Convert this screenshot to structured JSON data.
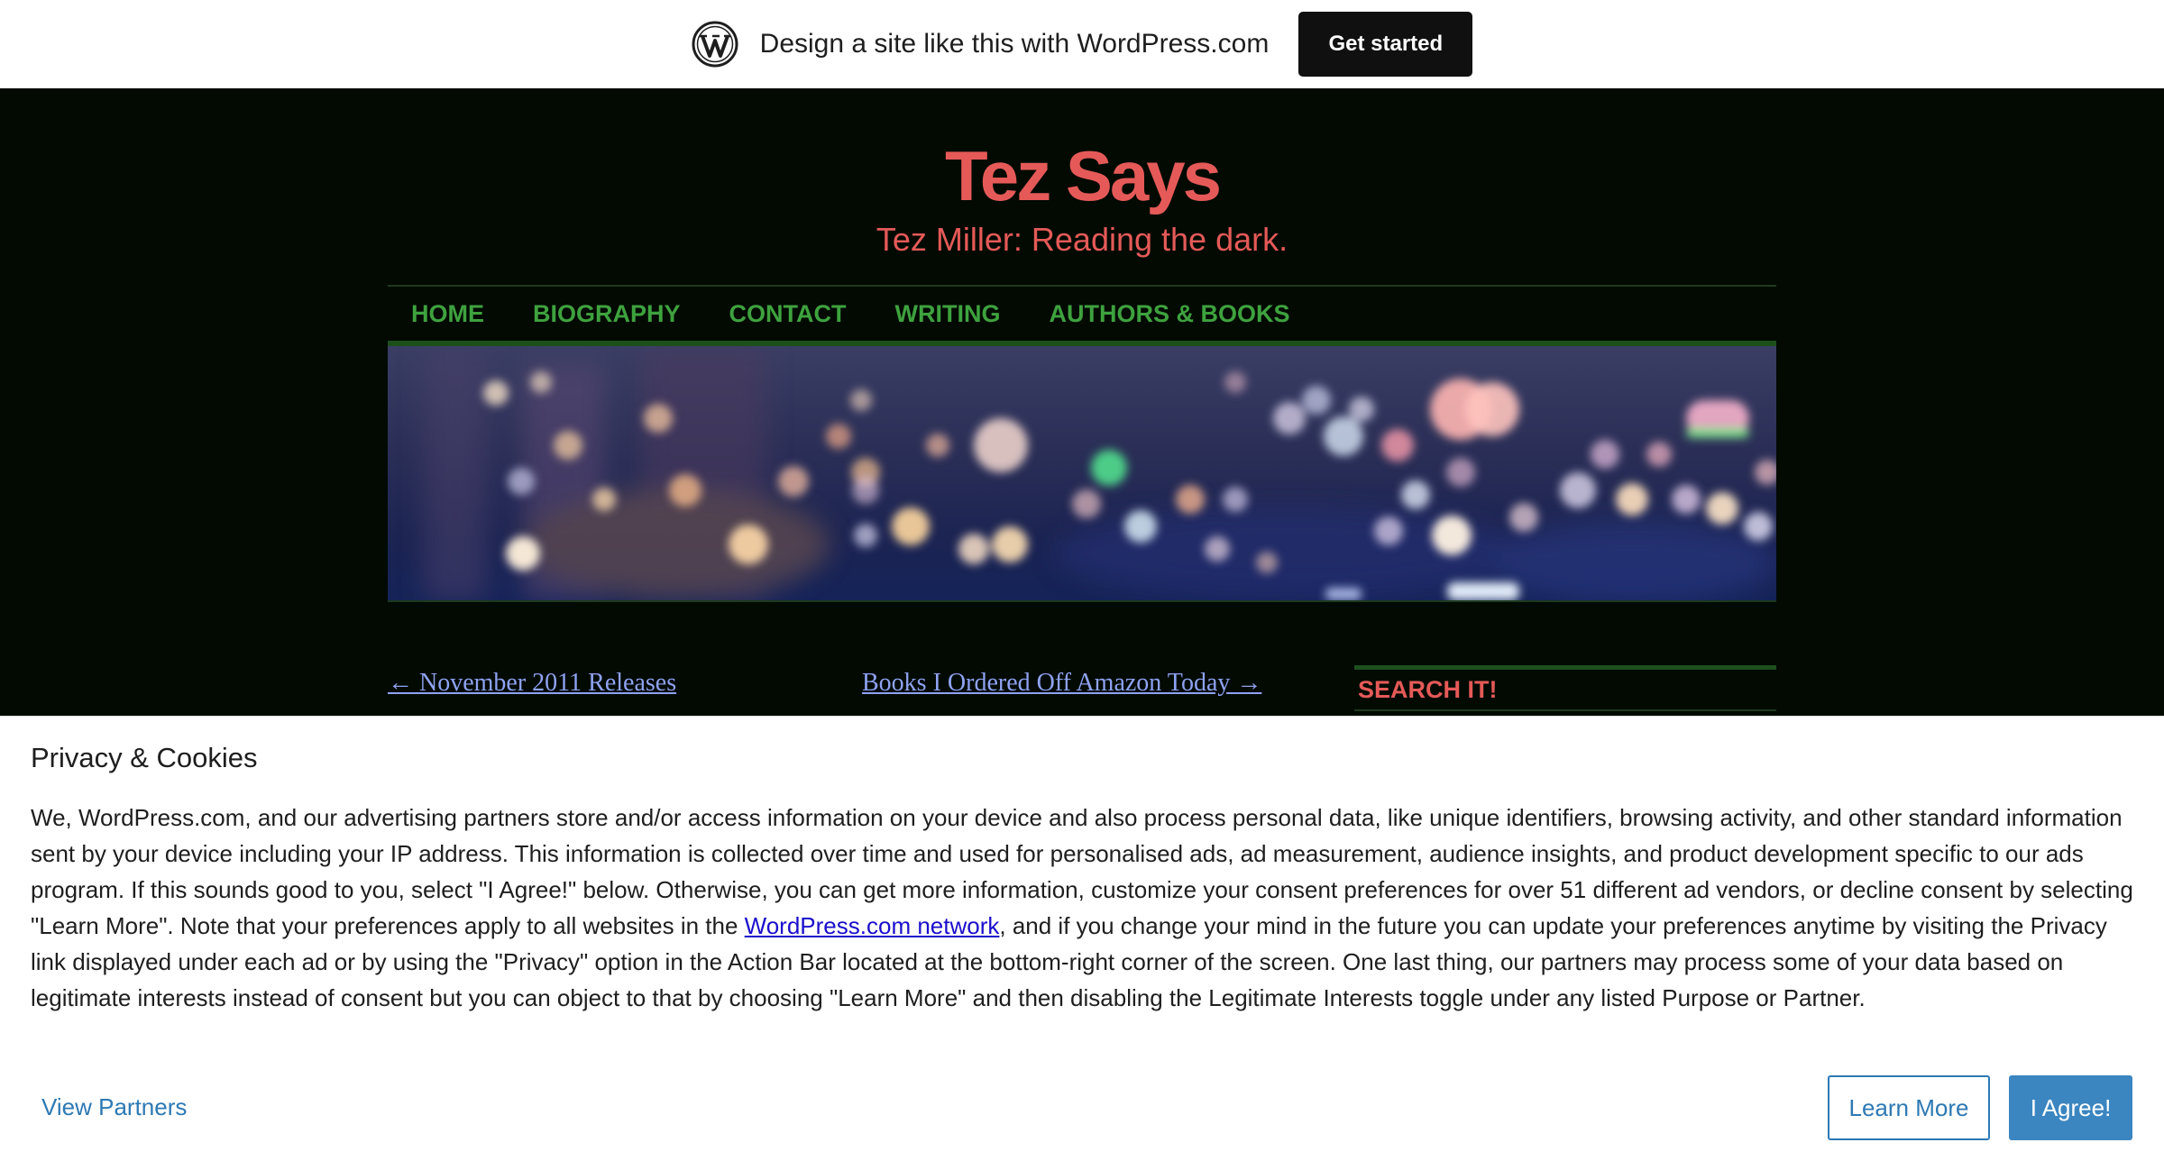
{
  "wp_bar": {
    "promo_text": "Design a site like this with WordPress.com",
    "cta_label": "Get started",
    "logo_icon": "wordpress-logo-icon"
  },
  "site": {
    "title": "Tez Says",
    "tagline": "Tez Miller: Reading the dark.",
    "accent_color": "#e55a58",
    "nav_color": "#3ea23e"
  },
  "nav": {
    "items": [
      {
        "label": "HOME"
      },
      {
        "label": "BIOGRAPHY"
      },
      {
        "label": "CONTACT"
      },
      {
        "label": "WRITING"
      },
      {
        "label": "AUTHORS & BOOKS"
      }
    ]
  },
  "post_nav": {
    "previous": "← November 2011 Releases",
    "next": "Books I Ordered Off Amazon Today →"
  },
  "sidebar": {
    "search_heading": "SEARCH IT!"
  },
  "privacy": {
    "title": "Privacy & Cookies",
    "body_part1": "We, WordPress.com, and our advertising partners store and/or access information on your device and also process personal data, like unique identifiers, browsing activity, and other standard information sent by your device including your IP address. This information is collected over time and used for personalised ads, ad measurement, audience insights, and product development specific to our ads program. If this sounds good to you, select \"I Agree!\" below. Otherwise, you can get more information, customize your consent preferences for over 51 different ad vendors, or decline consent by selecting \"Learn More\". Note that your preferences apply to all websites in the ",
    "network_link": "WordPress.com network",
    "body_part2": ", and if you change your mind in the future you can update your preferences anytime by visiting the Privacy link displayed under each ad or by using the \"Privacy\" option in the Action Bar located at the bottom-right corner of the screen. One last thing, our partners may process some of your data based on legitimate interests instead of consent but you can object to that by choosing \"Learn More\" and then disabling the Legitimate Interests toggle under any listed Purpose or Partner.",
    "view_partners_label": "View Partners",
    "learn_more_label": "Learn More",
    "agree_label": "I Agree!",
    "button_color": "#3b86c1"
  }
}
